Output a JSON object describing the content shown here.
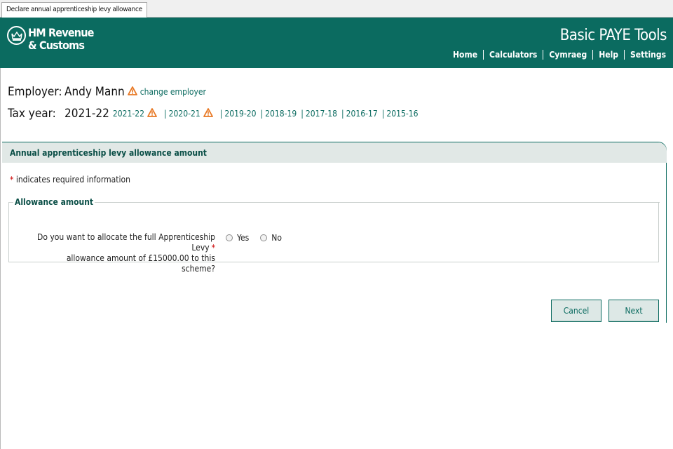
{
  "tab": {
    "title": "Declare annual apprenticeship levy allowance"
  },
  "header": {
    "brand_line1": "HM Revenue",
    "brand_line2": "& Customs",
    "app_title": "Basic PAYE Tools",
    "nav": [
      "Home",
      "Calculators",
      "Cymraeg",
      "Help",
      "Settings"
    ]
  },
  "employer": {
    "label": "Employer:",
    "name": "Andy Mann",
    "change_link": "change employer"
  },
  "tax_year": {
    "label": "Tax year:",
    "current": "2021-22",
    "years": [
      "2021-22",
      "2020-21",
      "2019-20",
      "2018-19",
      "2017-18",
      "2016-17",
      "2015-16"
    ]
  },
  "panel": {
    "title": "Annual apprenticeship levy allowance amount",
    "required_star": "*",
    "required_note": " indicates required information",
    "fieldset_legend": "Allowance amount",
    "question_line1": "Do you want to allocate the full Apprenticeship Levy",
    "question_line2": "allowance amount of £15000.00 to this scheme?",
    "question_star": "*",
    "options": [
      "Yes",
      "No"
    ]
  },
  "buttons": {
    "cancel": "Cancel",
    "next": "Next"
  },
  "colors": {
    "brand": "#0b6b60",
    "warning": "#e87722",
    "required": "#cc0000"
  }
}
